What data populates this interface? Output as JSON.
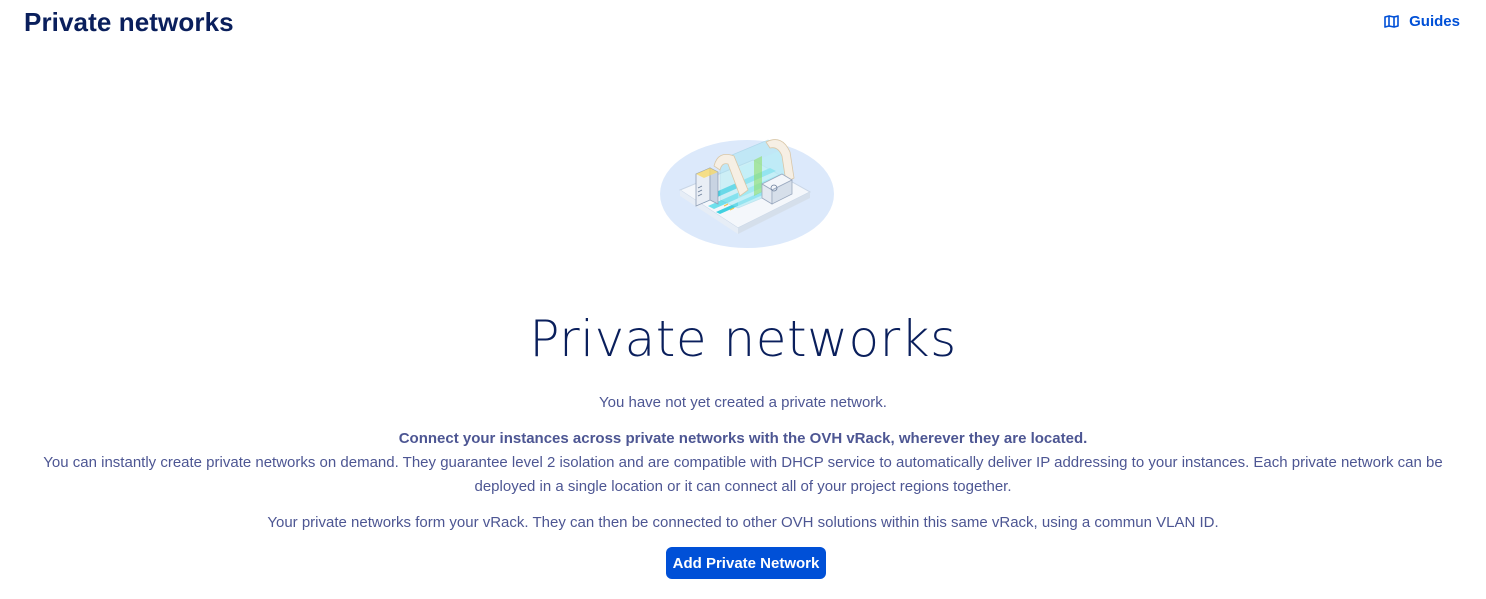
{
  "header": {
    "title": "Private networks",
    "guides_label": "Guides"
  },
  "empty_state": {
    "illustration": "private-network-illustration",
    "title": "Private networks",
    "no_network_text": "You have not yet created a private network.",
    "pitch_bold": "Connect your instances across private networks with the OVH vRack, wherever they are located.",
    "pitch_description": "You can instantly create private networks on demand. They guarantee level 2 isolation and are compatible with DHCP service to automatically deliver IP addressing to your instances. Each private network can be deployed in a single location or it can connect all of your project regions together.",
    "vrack_text": "Your private networks form your vRack. They can then be connected to other OVH solutions within this same vRack, using a commun VLAN ID.",
    "add_button_label": "Add Private Network"
  },
  "colors": {
    "title": "#0a1f5c",
    "body_text": "#4d5693",
    "primary": "#0050d7"
  }
}
